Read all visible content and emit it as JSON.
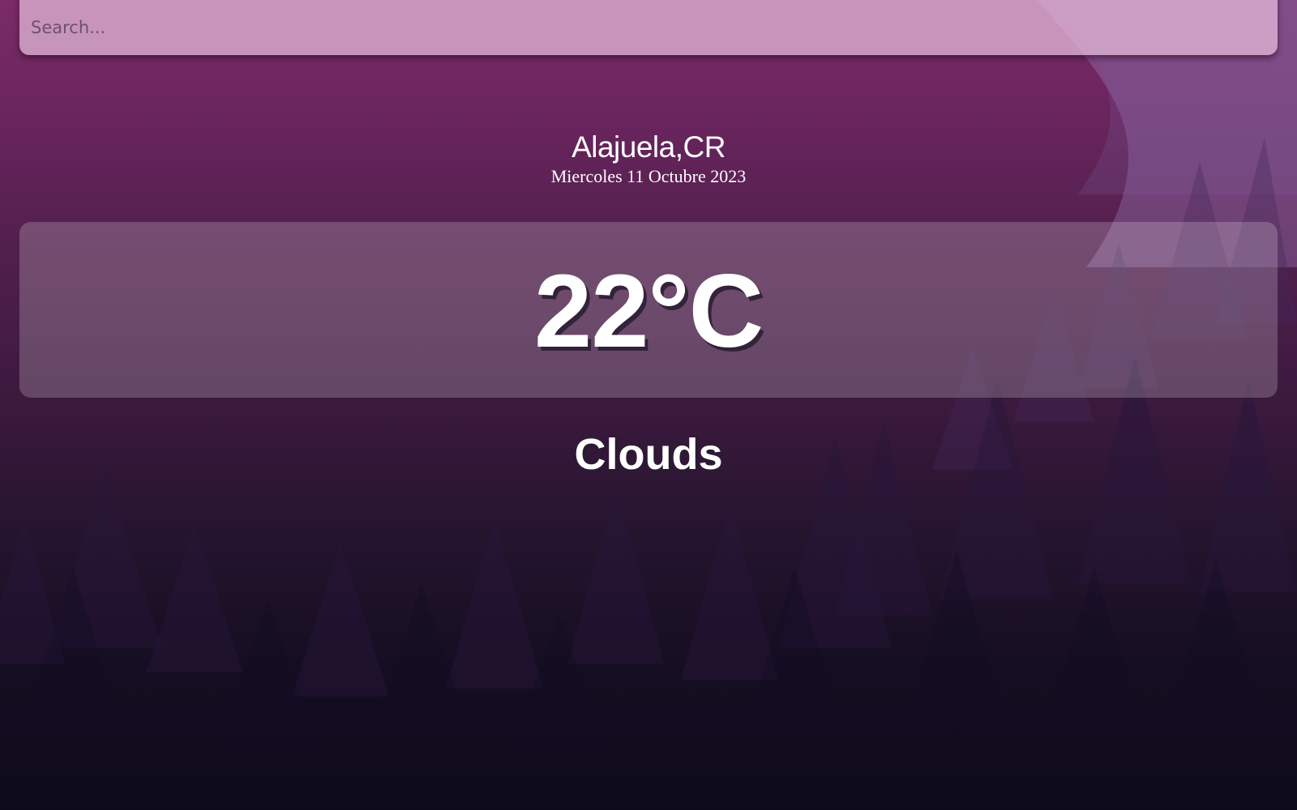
{
  "search": {
    "placeholder": "Search...",
    "value": ""
  },
  "location": {
    "city": "Alajuela,CR",
    "date": "Miercoles 11 Octubre 2023"
  },
  "weather": {
    "temperature": "22°C",
    "condition": "Clouds"
  },
  "colors": {
    "background_top": "#7a2b68",
    "background_bottom": "#0d0b1b",
    "text": "#ffffff",
    "search_bar": "#e8bede"
  },
  "background_image": "purple-forest-silhouette"
}
